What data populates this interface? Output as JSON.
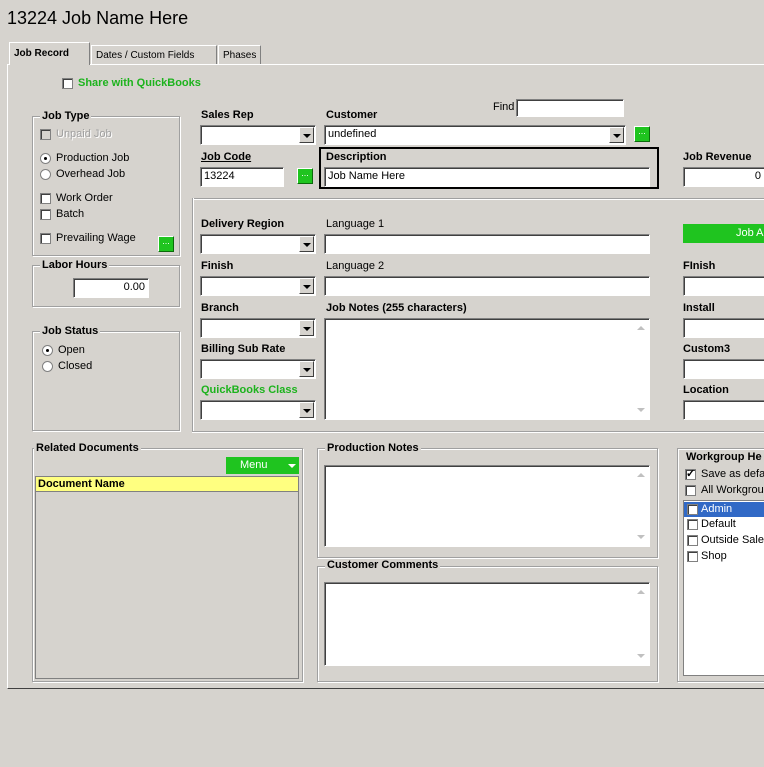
{
  "window": {
    "title": "13224 Job Name Here"
  },
  "tabs": [
    {
      "label": "Job Record"
    },
    {
      "label": "Dates  / Custom Fields"
    },
    {
      "label": "Phases"
    }
  ],
  "share_quickbooks": {
    "label": "Share with QuickBooks",
    "checked": false
  },
  "job_type": {
    "title": "Job Type",
    "unpaid_job": "Unpaid Job",
    "production_job": "Production Job",
    "overhead_job": "Overhead Job",
    "work_order": "Work Order",
    "batch": "Batch",
    "prevailing_wage": "Prevailing Wage",
    "ellipsis": "..."
  },
  "labor_hours": {
    "title": "Labor Hours",
    "value": "0.00"
  },
  "job_status": {
    "title": "Job Status",
    "open": "Open",
    "closed": "Closed",
    "selected": "Open"
  },
  "sales_rep": {
    "label": "Sales Rep",
    "value": ""
  },
  "customer": {
    "label": "Customer",
    "value": "undefined"
  },
  "find": {
    "label": "Find",
    "value": ""
  },
  "job_code": {
    "label": "Job Code",
    "value": "13224"
  },
  "description": {
    "label": "Description",
    "value": "Job Name Here"
  },
  "job_revenue": {
    "label": "Job Revenue",
    "value": "0"
  },
  "delivery_region": {
    "label": "Delivery Region",
    "value": ""
  },
  "language1": {
    "label": "Language 1",
    "value": ""
  },
  "finish": {
    "label": "Finish",
    "value": ""
  },
  "language2": {
    "label": "Language 2",
    "value": ""
  },
  "branch": {
    "label": "Branch",
    "value": ""
  },
  "job_notes": {
    "label": "Job Notes (255 characters)",
    "value": ""
  },
  "billing_sub_rate": {
    "label": "Billing Sub Rate",
    "value": ""
  },
  "quickbooks_class": {
    "label": "QuickBooks Class",
    "value": ""
  },
  "right_col": {
    "job_a_button": "Job A",
    "finish_label": "FInish",
    "install_label": "Install",
    "custom3_label": "Custom3",
    "location_label": "Location"
  },
  "related_documents": {
    "title": "Related Documents",
    "menu_label": "Menu",
    "column_header": "Document Name"
  },
  "production_notes": {
    "title": "Production Notes"
  },
  "customer_comments": {
    "title": "Customer Comments"
  },
  "workgroup": {
    "title": "Workgroup He",
    "save_default": "Save as defa",
    "all_workgroups": "All Workgrou",
    "items": [
      "Admin",
      "Default",
      "Outside Sale",
      "Shop"
    ],
    "selected": "Admin"
  },
  "colors": {
    "accent_green": "#1fc41f",
    "label_green": "#1db31d",
    "header_yellow": "#ffff80",
    "selection_blue": "#3169c6"
  }
}
